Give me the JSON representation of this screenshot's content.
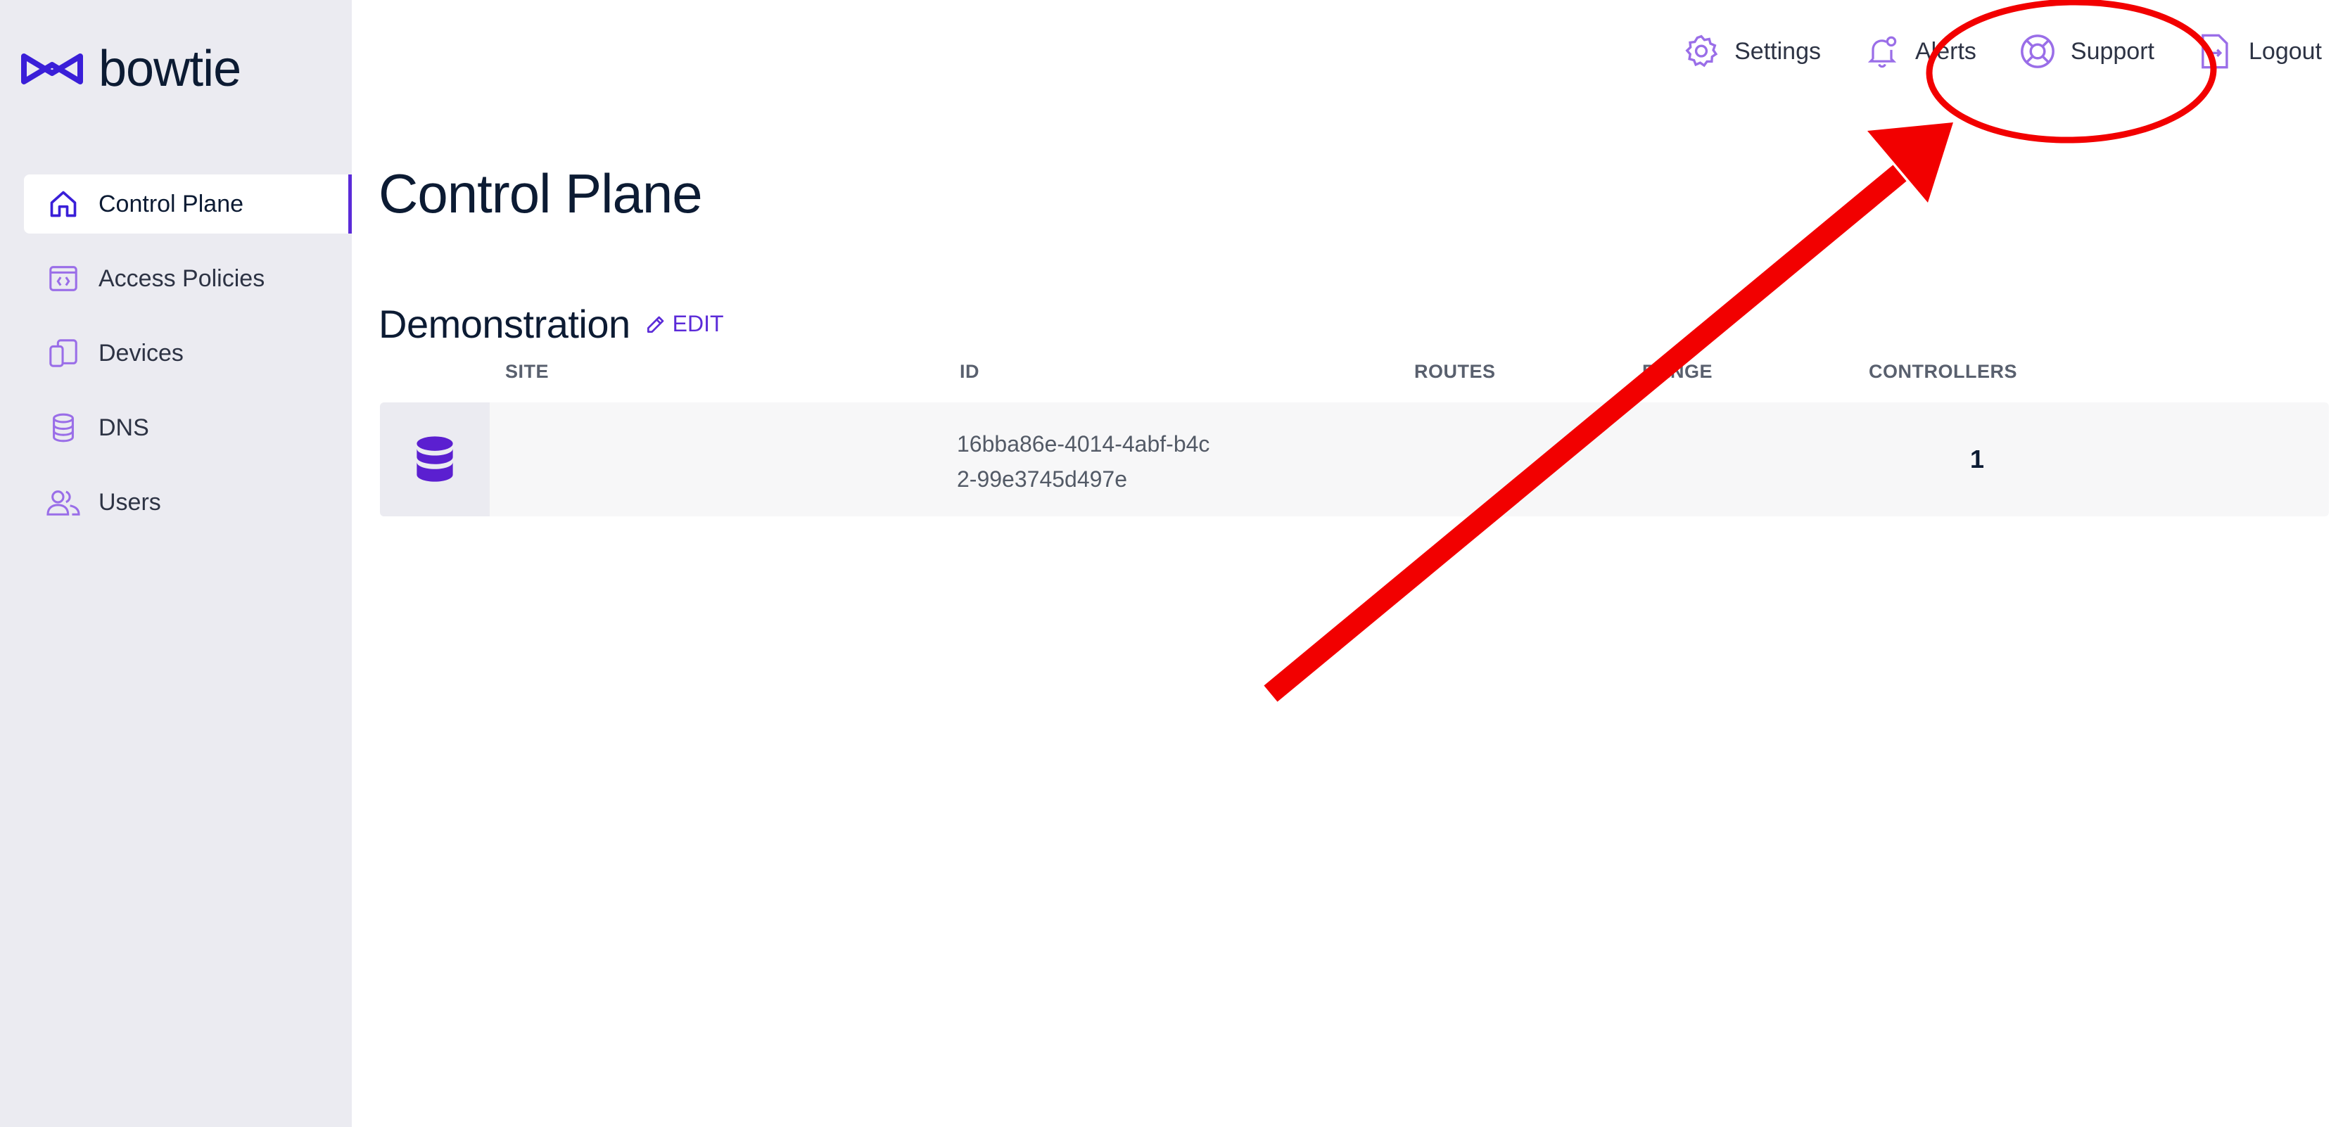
{
  "app": {
    "brand": "bowtie"
  },
  "colors": {
    "accent": "#5b2bd8",
    "sidebar_bg": "#ebebf1",
    "annotation": "#f20000"
  },
  "sidebar": {
    "items": [
      {
        "label": "Control Plane",
        "icon": "home-icon",
        "active": true
      },
      {
        "label": "Access Policies",
        "icon": "code-window-icon",
        "active": false
      },
      {
        "label": "Devices",
        "icon": "devices-icon",
        "active": false
      },
      {
        "label": "DNS",
        "icon": "database-icon",
        "active": false
      },
      {
        "label": "Users",
        "icon": "users-icon",
        "active": false
      }
    ]
  },
  "topbar": {
    "settings": "Settings",
    "alerts": "Alerts",
    "support": "Support",
    "logout": "Logout"
  },
  "main": {
    "title": "Control Plane",
    "section": {
      "title": "Demonstration",
      "edit_label": "EDIT"
    },
    "table": {
      "columns": {
        "site": "SITE",
        "id": "ID",
        "routes": "ROUTES",
        "range": "RANGE",
        "controllers": "CONTROLLERS"
      },
      "rows": [
        {
          "site": "",
          "id": "16bba86e-4014-4abf-b4c2-99e3745d497e",
          "routes": "",
          "range": "",
          "controllers": "1"
        }
      ]
    }
  }
}
